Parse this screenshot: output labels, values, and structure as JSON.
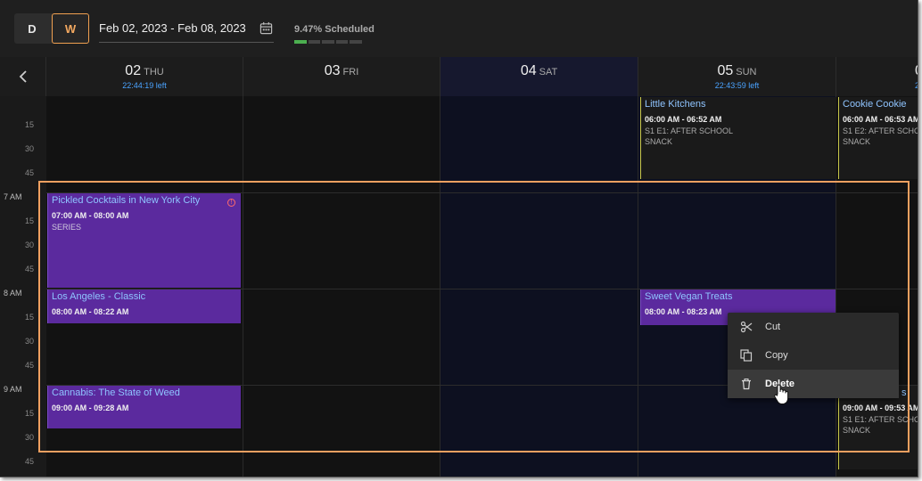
{
  "toolbar": {
    "view_day": "D",
    "view_week": "W",
    "date_range": "Feb 02, 2023 - Feb 08, 2023",
    "scheduled_label": "9.47% Scheduled",
    "scheduled_fraction": 0.0947
  },
  "days": [
    {
      "num": "02",
      "name": "THU",
      "time_left": "22:44:19 left"
    },
    {
      "num": "03",
      "name": "FRI",
      "time_left": ""
    },
    {
      "num": "04",
      "name": "SAT",
      "time_left": ""
    },
    {
      "num": "05",
      "name": "SUN",
      "time_left": "22:43:59 left"
    },
    {
      "num": "0",
      "name": "",
      "time_left": "2"
    }
  ],
  "time_labels": [
    "15",
    "30",
    "45",
    "7 AM",
    "15",
    "30",
    "45",
    "8 AM",
    "15",
    "30",
    "45",
    "9 AM",
    "15",
    "30",
    "45"
  ],
  "events": [
    {
      "title": "Pickled Cocktails in New York City",
      "time": "07:00 AM - 08:00 AM",
      "sub": "SERIES"
    },
    {
      "title": "Los Angeles - Classic",
      "time": "08:00 AM - 08:22 AM",
      "sub": ""
    },
    {
      "title": "Cannabis: The State of Weed",
      "time": "09:00 AM - 09:28 AM",
      "sub": ""
    },
    {
      "title": "Little Kitchens",
      "time": "06:00 AM - 06:52 AM",
      "sub": "S1 E1: AFTER SCHOOL",
      "sub2": "SNACK"
    },
    {
      "title": "Sweet Vegan Treats",
      "time": "08:00 AM - 08:23 AM",
      "sub": ""
    },
    {
      "title": "Cookie Cookie",
      "time": "06:00 AM - 06:53 AM",
      "sub": "S1 E2: AFTER SCHOO",
      "sub2": "SNACK"
    },
    {
      "title": "s",
      "time": "09:00 AM - 09:53 AM",
      "sub": "S1 E1: AFTER SCHOO",
      "sub2": "SNACK"
    }
  ],
  "context_menu": {
    "cut": "Cut",
    "copy": "Copy",
    "delete": "Delete"
  },
  "colors": {
    "accent_orange": "#f0a060",
    "event_purple": "#5b2a9e",
    "title_blue": "#8fc4ff",
    "progress_green": "#4caf50"
  }
}
